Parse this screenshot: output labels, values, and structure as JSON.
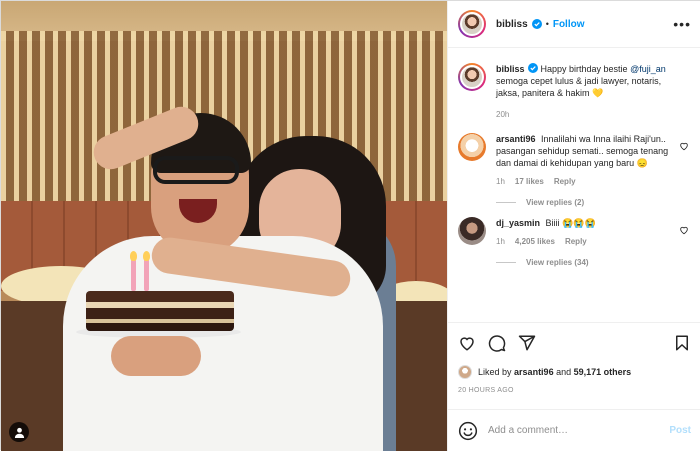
{
  "post": {
    "author": "bibliss",
    "follow_label": "Follow",
    "separator": "•",
    "more_label": "•••"
  },
  "caption": {
    "username": "bibliss",
    "text_before": "Happy birthday bestie ",
    "mention": "@fuji_an",
    "text_after": " semoga cepet lulus & jadi lawyer, notaris, jaksa, panitera & hakim 💛",
    "time": "20h"
  },
  "comments": [
    {
      "username": "arsanti96",
      "text": "Innalilahi wa Inna ilaihi Raji'un.. pasangan sehidup semati.. semoga tenang dan damai di kehidupan yang baru 😞",
      "time": "1h",
      "likes": "17 likes",
      "reply_label": "Reply",
      "view_replies": "View replies (2)"
    },
    {
      "username": "dj_yasmin",
      "text": "Biiii 😭😭😭",
      "time": "1h",
      "likes": "4,205 likes",
      "reply_label": "Reply",
      "view_replies": "View replies (34)"
    }
  ],
  "likes_line": {
    "prefix": "Liked by ",
    "user": "arsanti96",
    "middle": " and ",
    "count": "59,171 others"
  },
  "timestamp": "20 HOURS AGO",
  "add_comment": {
    "placeholder": "Add a comment…",
    "post_label": "Post"
  },
  "colors": {
    "link_blue": "#0095f6",
    "mention": "#00376b",
    "muted": "#8e8e8e",
    "post_disabled": "#b2dffc"
  },
  "icons": {
    "header": [
      "verified-icon",
      "more-icon"
    ],
    "actions": [
      "heart-icon",
      "comment-icon",
      "share-icon",
      "bookmark-icon"
    ],
    "photo": [
      "user-tag-icon"
    ],
    "footer": [
      "emoji-icon"
    ]
  }
}
